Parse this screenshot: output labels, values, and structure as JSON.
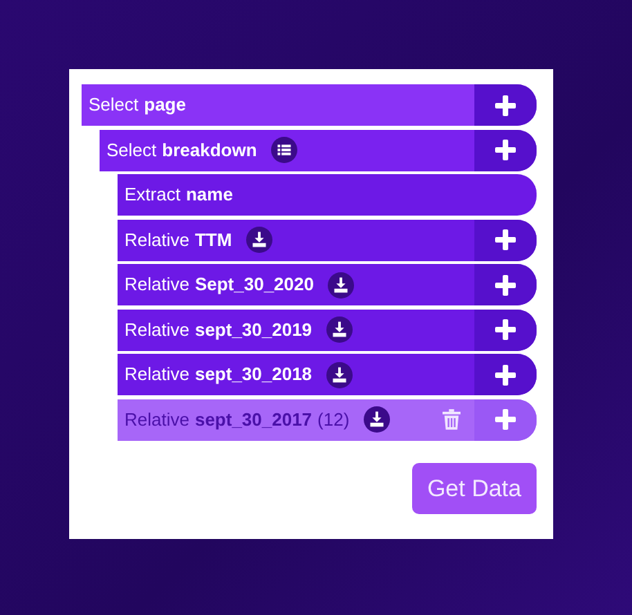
{
  "tree": [
    {
      "verb": "Select",
      "name": "page",
      "has_add": true,
      "selected": false,
      "children": [
        {
          "verb": "Select",
          "name": "breakdown",
          "kind": "list",
          "has_add": true,
          "selected": false,
          "children": [
            {
              "verb": "Extract",
              "name": "name",
              "has_add": false,
              "selected": false
            },
            {
              "verb": "Relative",
              "name": "TTM",
              "kind": "download",
              "has_add": true,
              "selected": false
            },
            {
              "verb": "Relative",
              "name": "Sept_30_2020",
              "kind": "download",
              "has_add": true,
              "selected": false
            },
            {
              "verb": "Relative",
              "name": "sept_30_2019",
              "kind": "download",
              "has_add": true,
              "selected": false
            },
            {
              "verb": "Relative",
              "name": "sept_30_2018",
              "kind": "download",
              "has_add": true,
              "selected": false
            },
            {
              "verb": "Relative",
              "name": "sept_30_2017",
              "count": "(12)",
              "kind": "download",
              "has_add": true,
              "selected": true
            }
          ]
        }
      ]
    }
  ],
  "button": "Get Data"
}
